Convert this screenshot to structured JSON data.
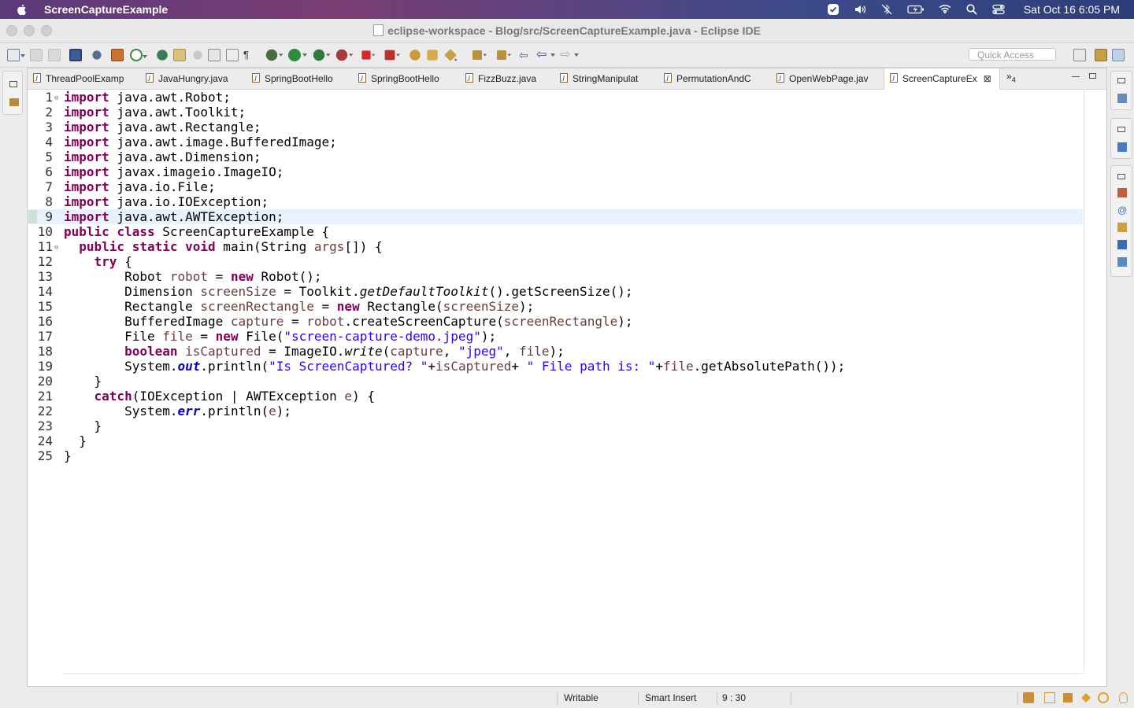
{
  "menubar": {
    "app_name": "ScreenCaptureExample",
    "clock": "Sat Oct 16  6:05 PM"
  },
  "window": {
    "title": "eclipse-workspace - Blog/src/ScreenCaptureExample.java - Eclipse IDE"
  },
  "toolbar": {
    "quick_access_placeholder": "Quick Access"
  },
  "tabs": [
    {
      "label": "ThreadPoolExamp"
    },
    {
      "label": "JavaHungry.java"
    },
    {
      "label": "SpringBootHello"
    },
    {
      "label": "SpringBootHello"
    },
    {
      "label": "FizzBuzz.java"
    },
    {
      "label": "StringManipulat"
    },
    {
      "label": "PermutationAndC"
    },
    {
      "label": "OpenWebPage.jav"
    },
    {
      "label": "ScreenCaptureEx",
      "active": true
    }
  ],
  "tabs_overflow": {
    "glyph": "»",
    "count": "4"
  },
  "editor": {
    "current_line": 9,
    "lines": [
      "1",
      "2",
      "3",
      "4",
      "5",
      "6",
      "7",
      "8",
      "9",
      "10",
      "11",
      "12",
      "13",
      "14",
      "15",
      "16",
      "17",
      "18",
      "19",
      "20",
      "21",
      "22",
      "23",
      "24",
      "25"
    ],
    "code": {
      "l1": [
        "import",
        " java.awt.Robot;"
      ],
      "l2": [
        "import",
        " java.awt.Toolkit;"
      ],
      "l3": [
        "import",
        " java.awt.Rectangle;"
      ],
      "l4": [
        "import",
        " java.awt.image.BufferedImage;"
      ],
      "l5": [
        "import",
        " java.awt.Dimension;"
      ],
      "l6": [
        "import",
        " javax.imageio.ImageIO;"
      ],
      "l7": [
        "import",
        " java.io.File;"
      ],
      "l8": [
        "import",
        " java.io.IOException;"
      ],
      "l9": [
        "import",
        " java.awt.AWTException;"
      ],
      "l10": [
        "public",
        " ",
        "class",
        " ScreenCaptureExample {"
      ],
      "l11": [
        "  ",
        "public",
        " ",
        "static",
        " ",
        "void",
        " main(String ",
        "args",
        "[]) {"
      ],
      "l12": [
        "    ",
        "try",
        " {"
      ],
      "l13": [
        "        Robot ",
        "robot",
        " = ",
        "new",
        " Robot();"
      ],
      "l14": [
        "        Dimension ",
        "screenSize",
        " = Toolkit.",
        "getDefaultToolkit",
        "().getScreenSize();"
      ],
      "l15": [
        "        Rectangle ",
        "screenRectangle",
        " = ",
        "new",
        " Rectangle(",
        "screenSize",
        ");"
      ],
      "l16": [
        "        BufferedImage ",
        "capture",
        " = ",
        "robot",
        ".createScreenCapture(",
        "screenRectangle",
        ");"
      ],
      "l17": [
        "        File ",
        "file",
        " = ",
        "new",
        " File(",
        "\"screen-capture-demo.jpeg\"",
        ");"
      ],
      "l18": [
        "        ",
        "boolean",
        " ",
        "isCaptured",
        " = ImageIO.",
        "write",
        "(",
        "capture",
        ", ",
        "\"jpeg\"",
        ", ",
        "file",
        ");"
      ],
      "l19": [
        "        System.",
        "out",
        ".println(",
        "\"Is ScreenCaptured? \"",
        "+",
        "isCaptured",
        "+ ",
        "\" File path is: \"",
        "+",
        "file",
        ".getAbsolutePath());"
      ],
      "l20": [
        "    }"
      ],
      "l21": [
        "    ",
        "catch",
        "(IOException | AWTException ",
        "e",
        ") {"
      ],
      "l22": [
        "        System.",
        "err",
        ".println(",
        "e",
        ");"
      ],
      "l23": [
        "    }"
      ],
      "l24": [
        "  }"
      ],
      "l25": [
        "}"
      ]
    }
  },
  "statusbar": {
    "writable": "Writable",
    "insert_mode": "Smart Insert",
    "position": "9 : 30"
  }
}
